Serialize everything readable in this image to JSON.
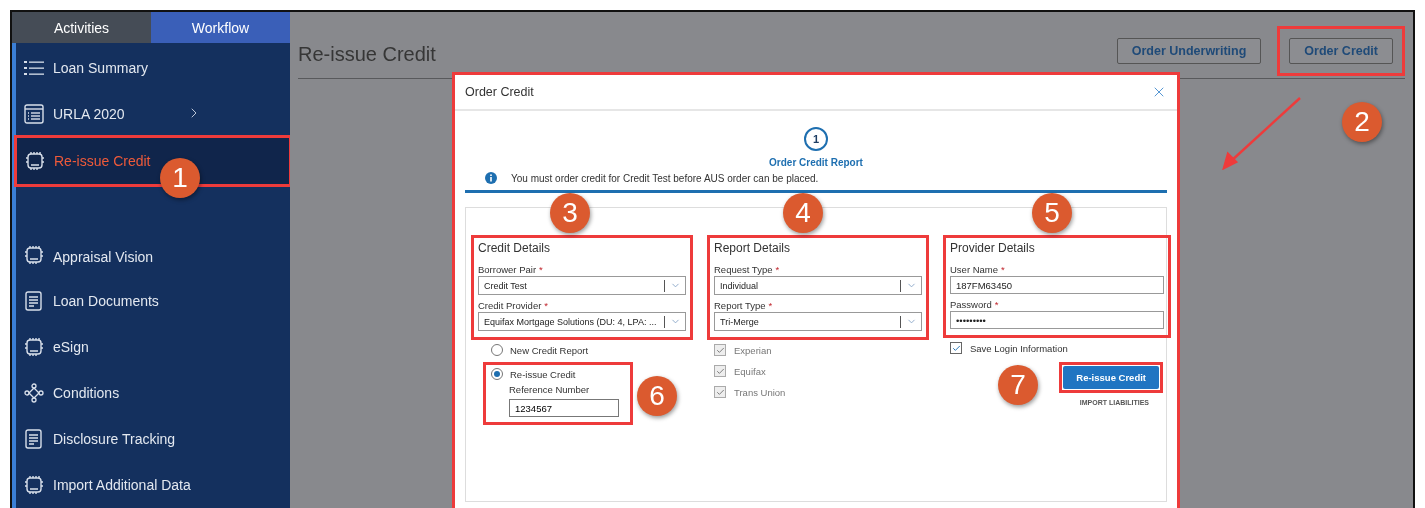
{
  "sidebar": {
    "tabs": [
      {
        "label": "Activities",
        "selected": false
      },
      {
        "label": "Workflow",
        "selected": true
      }
    ],
    "items": [
      {
        "label": "Loan Summary",
        "kind": "list",
        "selected": false,
        "expandable": false,
        "separated": false,
        "highlighted": false
      },
      {
        "label": "URLA 2020",
        "kind": "form",
        "selected": false,
        "expandable": true,
        "separated": false,
        "highlighted": false
      },
      {
        "label": "Re-issue Credit",
        "kind": "chip",
        "selected": true,
        "expandable": false,
        "separated": false,
        "highlighted": true
      },
      {
        "label": "Appraisal Vision",
        "kind": "chip",
        "selected": false,
        "expandable": false,
        "separated": true,
        "highlighted": false
      },
      {
        "label": "Loan Documents",
        "kind": "document",
        "selected": false,
        "expandable": false,
        "separated": false,
        "highlighted": false
      },
      {
        "label": "eSign",
        "kind": "chip",
        "selected": false,
        "expandable": false,
        "separated": false,
        "highlighted": false
      },
      {
        "label": "Conditions",
        "kind": "network",
        "selected": false,
        "expandable": false,
        "separated": false,
        "highlighted": false
      },
      {
        "label": "Disclosure Tracking",
        "kind": "document",
        "selected": false,
        "expandable": false,
        "separated": false,
        "highlighted": false
      },
      {
        "label": "Import Additional Data",
        "kind": "chip",
        "selected": false,
        "expandable": false,
        "separated": false,
        "highlighted": false
      }
    ]
  },
  "page": {
    "title": "Re-issue Credit",
    "buttons": [
      {
        "label": "Order Underwriting",
        "highlighted": false
      },
      {
        "label": "Order Credit",
        "highlighted": true
      }
    ]
  },
  "modal": {
    "title": "Order Credit",
    "highlighted": true,
    "step": {
      "number": "1",
      "label": "Order Credit Report"
    },
    "info": "You must order credit for Credit Test before AUS order can be placed.",
    "sections": [
      {
        "title": "Credit Details",
        "highlighted": true,
        "fields": [
          {
            "label": "Borrower Pair",
            "required_mark": "*",
            "kind": "select",
            "value": "Credit Test"
          },
          {
            "label": "Credit Provider",
            "required_mark": "*",
            "kind": "select",
            "value": "Equifax Mortgage Solutions (DU: 4, LPA: ..."
          }
        ],
        "options": [
          {
            "label": "New Credit Report",
            "selected": false,
            "highlighted": false
          },
          {
            "label": "Re-issue Credit",
            "selected": true,
            "highlighted": true,
            "reference": {
              "label": "Reference Number",
              "value": "1234567"
            }
          }
        ]
      },
      {
        "title": "Report Details",
        "highlighted": true,
        "fields": [
          {
            "label": "Request Type",
            "required_mark": "*",
            "kind": "select",
            "value": "Individual"
          },
          {
            "label": "Report Type",
            "required_mark": "*",
            "kind": "select",
            "value": "Tri-Merge"
          }
        ],
        "checks": [
          {
            "label": "Experian",
            "checked": true,
            "disabled": true
          },
          {
            "label": "Equifax",
            "checked": true,
            "disabled": true
          },
          {
            "label": "Trans Union",
            "checked": true,
            "disabled": true
          }
        ]
      },
      {
        "title": "Provider Details",
        "highlighted": true,
        "fields": [
          {
            "label": "User Name",
            "required_mark": "*",
            "kind": "text",
            "value": "187FM63450"
          },
          {
            "label": "Password",
            "required_mark": "*",
            "kind": "text",
            "value": "•••••••••"
          }
        ],
        "checks": [
          {
            "label": "Save Login Information",
            "checked": true,
            "disabled": false
          }
        ],
        "action": {
          "label": "Re-issue Credit",
          "highlighted": true
        },
        "link": "IMPORT LIABILITIES"
      }
    ]
  },
  "callouts": [
    "1",
    "2",
    "3",
    "4",
    "5",
    "6",
    "7"
  ]
}
